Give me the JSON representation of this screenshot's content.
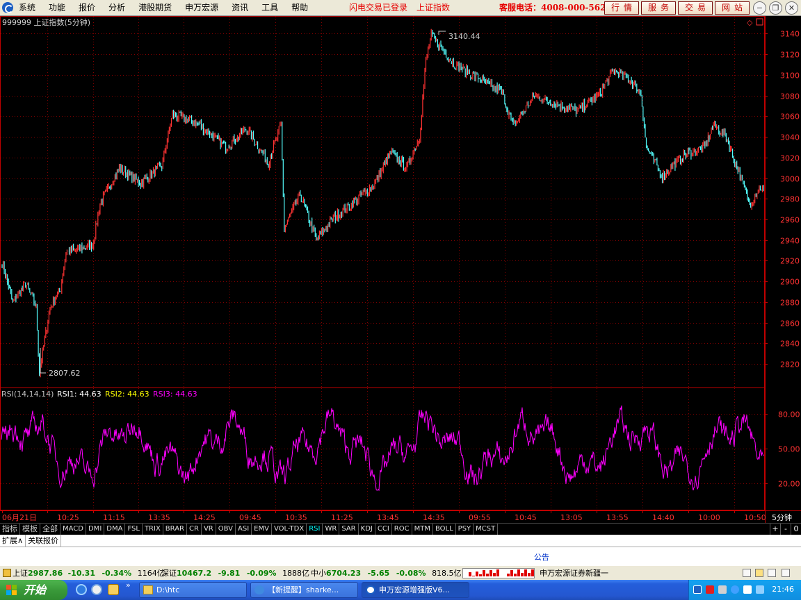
{
  "menu": {
    "items": [
      "系统",
      "功能",
      "报价",
      "分析",
      "港股期货",
      "申万宏源",
      "资讯",
      "工具",
      "帮助"
    ],
    "status_login": "闪电交易已登录",
    "status_index": "上证指数",
    "hotline": "客服电话：4008-000-562",
    "quick_buttons": [
      "行情",
      "服务",
      "交易",
      "网站"
    ]
  },
  "chart_header": {
    "title": "999999 上证指数(5分钟)",
    "high_label": "3140.44",
    "low_label": "2807.62"
  },
  "rsi_header": {
    "label": "RSI(14,14,14)",
    "rsi1": "RSI1: 44.63",
    "rsi2": "RSI2: 44.63",
    "rsi3": "RSI3: 44.63"
  },
  "period_label": "5分钟",
  "indicator_tabs": [
    "指标",
    "模板",
    "全部",
    "MACD",
    "DMI",
    "DMA",
    "FSL",
    "TRIX",
    "BRAR",
    "CR",
    "VR",
    "OBV",
    "ASI",
    "EMV",
    "VOL-TDX",
    "RSI",
    "WR",
    "SAR",
    "KDJ",
    "CCI",
    "ROC",
    "MTM",
    "BOLL",
    "PSY",
    "MCST"
  ],
  "right_controls": [
    "+",
    "-",
    "0"
  ],
  "ext_row": [
    "扩展∧",
    "关联报价"
  ],
  "notice": "公告",
  "status": {
    "sh_label": "上证",
    "sh_price": "2987.86",
    "sh_change": "-10.31",
    "sh_pct": "-0.34%",
    "sh_amount": "1164亿",
    "sz_label": "深证",
    "sz_price": "10467.2",
    "sz_change": "-9.81",
    "sz_pct": "-0.09%",
    "sz_amount": "1888亿",
    "zx_label": "中小",
    "zx_price": "6704.23",
    "zx_change": "-5.65",
    "zx_pct": "-0.08%",
    "zx_amount": "818.5亿",
    "broker": "申万宏源证券新疆一"
  },
  "taskbar": {
    "start": "开始",
    "tasks": [
      "D:\\htc",
      "【新提醒】sharke...",
      "申万宏源增强版V6..."
    ],
    "clock": "21:46"
  },
  "colors": {
    "up": "#ff3232",
    "down": "#54fcfc",
    "rsi": "#ff00ff",
    "grid": "#800000",
    "axis": "#c00000"
  },
  "chart_data": [
    {
      "type": "candlestick",
      "title": "999999 上证指数(5分钟)",
      "ylim": [
        2800,
        3150
      ],
      "yticks": [
        2820,
        2840,
        2860,
        2880,
        2900,
        2920,
        2940,
        2960,
        2980,
        3000,
        3020,
        3040,
        3060,
        3080,
        3100,
        3120,
        3140
      ],
      "annotations": [
        {
          "label": "3140.44",
          "value": 3140.44
        },
        {
          "label": "2807.62",
          "value": 2807.62
        }
      ],
      "x_ticks": [
        "06月21日",
        "10:25",
        "11:15",
        "13:35",
        "14:25",
        "09:45",
        "10:35",
        "11:25",
        "13:45",
        "14:35",
        "09:55",
        "10:45",
        "13:05",
        "13:55",
        "14:40",
        "10:00",
        "10:50"
      ],
      "key_points": [
        {
          "i": 0,
          "v": 2918
        },
        {
          "i": 10,
          "v": 2880
        },
        {
          "i": 22,
          "v": 2898
        },
        {
          "i": 32,
          "v": 2875
        },
        {
          "i": 35,
          "v": 2812
        },
        {
          "i": 45,
          "v": 2875
        },
        {
          "i": 55,
          "v": 2893
        },
        {
          "i": 60,
          "v": 2928
        },
        {
          "i": 85,
          "v": 2935
        },
        {
          "i": 92,
          "v": 2975
        },
        {
          "i": 110,
          "v": 3010
        },
        {
          "i": 130,
          "v": 2995
        },
        {
          "i": 150,
          "v": 3012
        },
        {
          "i": 160,
          "v": 3062
        },
        {
          "i": 185,
          "v": 3052
        },
        {
          "i": 210,
          "v": 3030
        },
        {
          "i": 230,
          "v": 3048
        },
        {
          "i": 250,
          "v": 3015
        },
        {
          "i": 262,
          "v": 3052
        },
        {
          "i": 265,
          "v": 2950
        },
        {
          "i": 280,
          "v": 2985
        },
        {
          "i": 295,
          "v": 2940
        },
        {
          "i": 310,
          "v": 2960
        },
        {
          "i": 335,
          "v": 2980
        },
        {
          "i": 350,
          "v": 2995
        },
        {
          "i": 365,
          "v": 3025
        },
        {
          "i": 380,
          "v": 3010
        },
        {
          "i": 392,
          "v": 3040
        },
        {
          "i": 398,
          "v": 3115
        },
        {
          "i": 403,
          "v": 3138
        },
        {
          "i": 425,
          "v": 3110
        },
        {
          "i": 450,
          "v": 3095
        },
        {
          "i": 470,
          "v": 3082
        },
        {
          "i": 480,
          "v": 3050
        },
        {
          "i": 500,
          "v": 3080
        },
        {
          "i": 520,
          "v": 3072
        },
        {
          "i": 540,
          "v": 3065
        },
        {
          "i": 560,
          "v": 3080
        },
        {
          "i": 575,
          "v": 3105
        },
        {
          "i": 590,
          "v": 3095
        },
        {
          "i": 600,
          "v": 3082
        },
        {
          "i": 605,
          "v": 3030
        },
        {
          "i": 620,
          "v": 3002
        },
        {
          "i": 640,
          "v": 3022
        },
        {
          "i": 660,
          "v": 3030
        },
        {
          "i": 668,
          "v": 3052
        },
        {
          "i": 680,
          "v": 3040
        },
        {
          "i": 692,
          "v": 3005
        },
        {
          "i": 702,
          "v": 2975
        },
        {
          "i": 712,
          "v": 2992
        },
        {
          "i": 715,
          "v": 2987
        }
      ],
      "bars": 716
    },
    {
      "type": "line",
      "title": "RSI(14,14,14)",
      "ylim": [
        10,
        95
      ],
      "yticks": [
        20.0,
        50.0,
        80.0
      ],
      "series": [
        {
          "name": "RSI1",
          "last": 44.63
        },
        {
          "name": "RSI2",
          "last": 44.63
        },
        {
          "name": "RSI3",
          "last": 44.63
        }
      ]
    }
  ]
}
